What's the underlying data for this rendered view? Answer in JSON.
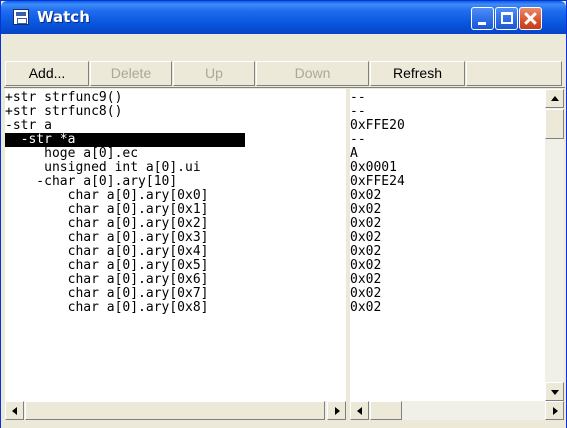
{
  "window": {
    "title": "Watch",
    "app_icon": "watch-window-icon",
    "controls": {
      "minimize_icon": "minimize-icon",
      "maximize_icon": "maximize-icon",
      "close_icon": "close-icon"
    }
  },
  "toolbar": {
    "add_label": "Add...",
    "delete_label": "Delete",
    "up_label": "Up",
    "down_label": "Down",
    "refresh_label": "Refresh",
    "extra_label": ""
  },
  "colors": {
    "titlebar": "#0855dd",
    "selection_bg": "#000000",
    "selection_text": "#ffffff",
    "disabled_text": "#aca899"
  },
  "watch": {
    "rows": [
      {
        "expr": "+str strfunc9()",
        "value": "--"
      },
      {
        "expr": "+str strfunc8()",
        "value": "--"
      },
      {
        "expr": "-str a",
        "value": "0xFFE20"
      },
      {
        "expr": "  -str *a",
        "value": "--"
      },
      {
        "expr": "     hoge a[0].ec",
        "value": "A"
      },
      {
        "expr": "     unsigned int a[0].ui",
        "value": "0x0001"
      },
      {
        "expr": "    -char a[0].ary[10]",
        "value": "0xFFE24"
      },
      {
        "expr": "        char a[0].ary[0x0]",
        "value": "0x02"
      },
      {
        "expr": "        char a[0].ary[0x1]",
        "value": "0x02"
      },
      {
        "expr": "        char a[0].ary[0x2]",
        "value": "0x02"
      },
      {
        "expr": "        char a[0].ary[0x3]",
        "value": "0x02"
      },
      {
        "expr": "        char a[0].ary[0x4]",
        "value": "0x02"
      },
      {
        "expr": "        char a[0].ary[0x5]",
        "value": "0x02"
      },
      {
        "expr": "        char a[0].ary[0x6]",
        "value": "0x02"
      },
      {
        "expr": "        char a[0].ary[0x7]",
        "value": "0x02"
      },
      {
        "expr": "        char a[0].ary[0x8]",
        "value": "0x02"
      }
    ],
    "selected_row": 3
  },
  "scrollbars": {
    "vertical_icons": {
      "up": "scroll-up-arrow-icon",
      "down": "scroll-down-arrow-icon"
    },
    "horizontal_icons": {
      "left": "scroll-left-arrow-icon",
      "right": "scroll-right-arrow-icon"
    }
  }
}
